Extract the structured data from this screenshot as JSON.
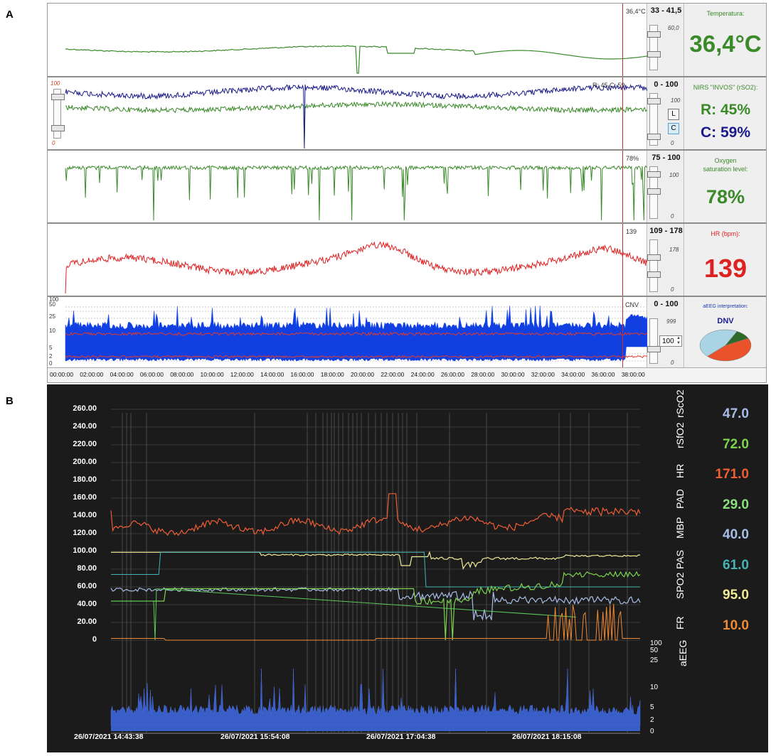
{
  "panel_labels": {
    "a": "A",
    "b": "B"
  },
  "panelA": {
    "tracks": [
      {
        "id": "temp",
        "range": "33 - 41,5",
        "scale_max": "60,0",
        "scale_min": "",
        "marker_label": "36,4°C",
        "side_title": "Temperatura:",
        "value": "36,4°C",
        "value_color": "#3a8a2a"
      },
      {
        "id": "nirs",
        "range": "0 - 100",
        "scale_max": "100",
        "scale_min": "0",
        "marker_label": "R: 45 C: 59",
        "left_top": "100",
        "left_bottom": "0",
        "side_title": "NIRS \"INVOS\" (rSO2):",
        "value_r": "R: 45%",
        "value_c": "C: 59%",
        "button_l": "L",
        "button_c": "C",
        "value_r_color": "#3a8a2a",
        "value_c_color": "#1a1a8a"
      },
      {
        "id": "spo2",
        "range": "75 - 100",
        "scale_max": "100",
        "scale_min": "0",
        "marker_label": "78%",
        "side_title_1": "Oxygen",
        "side_title_2": "saturation level:",
        "value": "78%",
        "value_color": "#3a8a2a"
      },
      {
        "id": "hr",
        "range": "109 - 178",
        "scale_max": "178",
        "scale_min": "0",
        "marker_label": "139",
        "side_title": "HR (bpm):",
        "value": "139",
        "value_color": "#dd2222"
      },
      {
        "id": "aeeg",
        "range": "0 - 100",
        "scale_max": "999",
        "scale_min": "0",
        "marker_label": "CNV",
        "spin_value": "100",
        "side_title": "aEEG interpretation:",
        "interpretation": "DNV",
        "y_ticks": [
          "100",
          "50",
          "25",
          "10",
          "5",
          "2",
          "0"
        ],
        "pie_colors": [
          "#e9522a",
          "#a9d4e4",
          "#2d6a2a"
        ]
      }
    ],
    "time_ticks": [
      "00:00:00",
      "02:00:00",
      "04:00:00",
      "06:00:00",
      "08:00:00",
      "10:00:00",
      "12:00:00",
      "14:00:00",
      "16:00:00",
      "18:00:00",
      "20:00:00",
      "22:00:00",
      "24:00:00",
      "26:00:00",
      "28:00:00",
      "30:00:00",
      "32:00:00",
      "34:00:00",
      "36:00:00",
      "38:00:00"
    ]
  },
  "panelB": {
    "y_ticks": [
      "260.00",
      "240.00",
      "220.00",
      "200.00",
      "180.00",
      "160.00",
      "140.00",
      "120.00",
      "100.00",
      "80.00",
      "60.00",
      "40.00",
      "20.00",
      "0"
    ],
    "channels": [
      {
        "name": "rScO2",
        "value": "47.0",
        "color": "#a7bde6"
      },
      {
        "name": "rSfO2",
        "value": "72.0",
        "color": "#7ed24e"
      },
      {
        "name": "HR",
        "value": "171.0",
        "color": "#ee5e34"
      },
      {
        "name": "PAD",
        "value": "29.0",
        "color": "#8be07e"
      },
      {
        "name": "MBP",
        "value": "40.0",
        "color": "#a7bde6"
      },
      {
        "name": "PAS",
        "value": "61.0",
        "color": "#46b3b5"
      },
      {
        "name": "SPO2",
        "value": "95.0",
        "color": "#f0ec98"
      },
      {
        "name": "FR",
        "value": "10.0",
        "color": "#f08a34"
      }
    ],
    "aeeg_label": "aEEG",
    "aeeg_ticks": [
      "100",
      "50",
      "25",
      "10",
      "5",
      "2",
      "0"
    ],
    "x_ticks": [
      "26/07/2021 14:43:38",
      "26/07/2021 15:54:08",
      "26/07/2021 17:04:38",
      "26/07/2021 18:15:08"
    ]
  }
}
